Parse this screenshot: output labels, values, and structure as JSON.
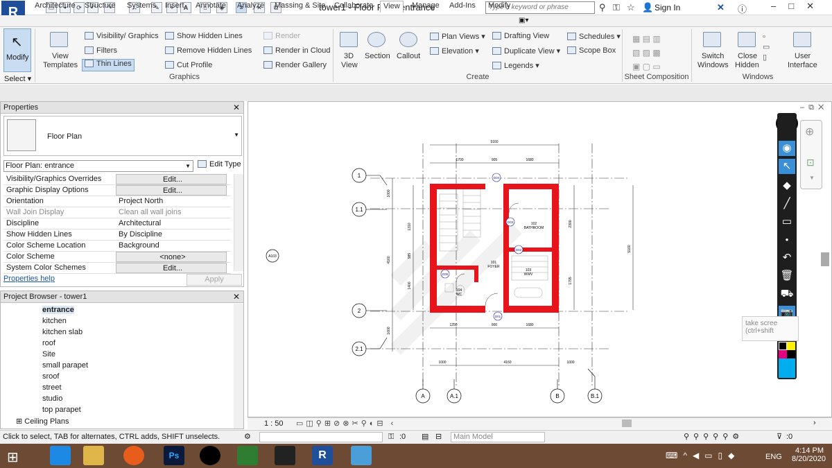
{
  "app": {
    "logo": "R",
    "title": "tower1 - Floor Plan: entrance",
    "search_placeholder": "Type a keyword or phrase",
    "sign_in": "Sign In"
  },
  "tabs": [
    "Architecture",
    "Structure",
    "Systems",
    "Insert",
    "Annotate",
    "Analyze",
    "Massing & Site",
    "Collaborate",
    "View",
    "Manage",
    "Add-Ins",
    "Modify"
  ],
  "active_tab": "View",
  "ribbon": {
    "modify": "Modify",
    "select": "Select",
    "view_templates": [
      "View",
      "Templates"
    ],
    "visibility": "Visibility/ Graphics",
    "filters": "Filters",
    "thin_lines": "Thin Lines",
    "show_hidden": "Show Hidden Lines",
    "remove_hidden": "Remove Hidden Lines",
    "cut_profile": "Cut Profile",
    "render": "Render",
    "render_cloud": "Render in Cloud",
    "render_gallery": "Render Gallery",
    "graphics_panel": "Graphics",
    "view3d": [
      "3D",
      "View"
    ],
    "section": "Section",
    "callout": "Callout",
    "plan_views": "Plan Views",
    "elevation": "Elevation",
    "drafting_view": "Drafting View",
    "duplicate_view": "Duplicate View",
    "legends": "Legends",
    "schedules": "Schedules",
    "scope_box": "Scope Box",
    "create_panel": "Create",
    "sheet_panel": "Sheet Composition",
    "switch_windows": [
      "Switch",
      "Windows"
    ],
    "close_hidden": [
      "Close",
      "Hidden"
    ],
    "user_interface": [
      "User",
      "Interface"
    ],
    "windows_panel": "Windows"
  },
  "properties": {
    "header": "Properties",
    "type_name": "Floor Plan",
    "instance": "Floor Plan: entrance",
    "edit_type": "Edit Type",
    "rows": [
      {
        "name": "Visibility/Graphics Overrides",
        "value": "Edit..."
      },
      {
        "name": "Graphic Display Options",
        "value": "Edit..."
      },
      {
        "name": "Orientation",
        "value": "Project North"
      },
      {
        "name": "Wall Join Display",
        "value": "Clean all wall joins"
      },
      {
        "name": "Discipline",
        "value": "Architectural"
      },
      {
        "name": "Show Hidden Lines",
        "value": "By Discipline"
      },
      {
        "name": "Color Scheme Location",
        "value": "Background"
      },
      {
        "name": "Color Scheme",
        "value": "<none>"
      },
      {
        "name": "System Color Schemes",
        "value": "Edit..."
      }
    ],
    "help": "Properties help",
    "apply": "Apply"
  },
  "browser": {
    "header": "Project Browser - tower1",
    "items": [
      "entrance",
      "kitchen",
      "kitchen slab",
      "roof",
      "Site",
      "small parapet",
      "sroof",
      "street",
      "studio",
      "top parapet"
    ],
    "ceiling": "Ceiling Plans"
  },
  "plan": {
    "grid_rows": [
      "1",
      "1.1",
      "2",
      "2.1"
    ],
    "grid_cols": [
      "A",
      "A.1",
      "B",
      "B.1"
    ],
    "dims_top": [
      "5160",
      "1700",
      "905",
      "1680"
    ],
    "dims_bottom": [
      "1250",
      "900",
      "1680"
    ],
    "dims_overall_bottom": [
      "1000",
      "4160",
      "1000"
    ],
    "dims_left_outer": [
      "1000",
      "4160",
      "1000"
    ],
    "dims_left_inner": [
      "1310",
      "985",
      "1400"
    ],
    "dims_right": [
      "2300",
      "1795"
    ],
    "dim_right_overall": "5160",
    "rooms": [
      {
        "num": "102",
        "name": "BATHROOM"
      },
      {
        "num": "101",
        "name": "FOYER"
      },
      {
        "num": "103",
        "name": "WWV"
      },
      {
        "num": "104",
        "name": "WC"
      }
    ],
    "doors": [
      "D04",
      "D03",
      "D02",
      "D05",
      "D01"
    ],
    "section_tag": "A103"
  },
  "viewbar": {
    "scale": "1 : 50"
  },
  "status": {
    "message": "Click to select, TAB for alternates, CTRL adds, SHIFT unselects.",
    "count1": ":0",
    "model": "Main Model",
    "filter": ":0"
  },
  "tooltip": {
    "line1": "take scree",
    "line2": "(ctrl+shift"
  },
  "clock": {
    "time": "4:14 PM",
    "date": "8/20/2020",
    "lang": "ENG"
  }
}
